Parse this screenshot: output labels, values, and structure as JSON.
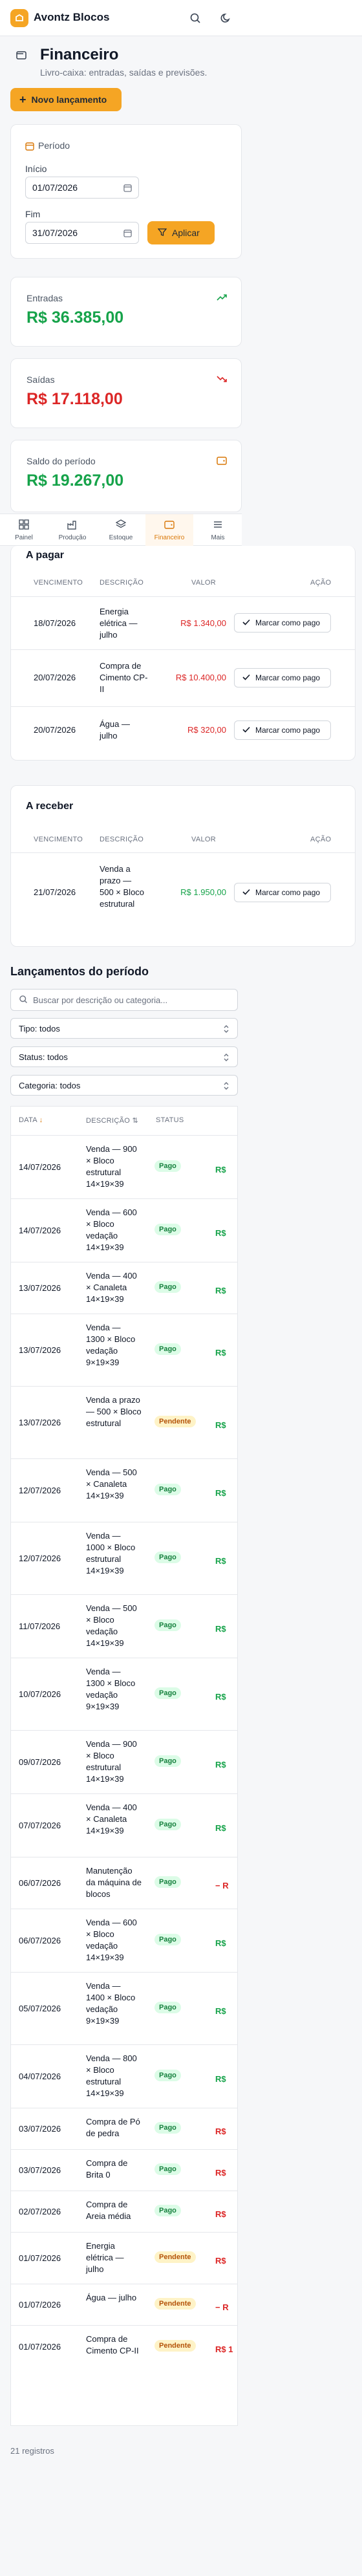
{
  "app": {
    "name": "Avontz Blocos"
  },
  "page": {
    "title": "Financeiro",
    "subtitle": "Livro-caixa: entradas, saídas e previsões.",
    "new_button": "Novo lançamento"
  },
  "period": {
    "title": "Período",
    "start_label": "Início",
    "start_value": "01/07/2026",
    "end_label": "Fim",
    "end_value": "31/07/2026",
    "apply_label": "Aplicar"
  },
  "stats": [
    {
      "label": "Entradas",
      "value": "R$ 36.385,00",
      "color": "#16a34a",
      "icon": "trending-up-icon"
    },
    {
      "label": "Saídas",
      "value": "R$ 17.118,00",
      "color": "#dc2626",
      "icon": "trending-down-icon"
    },
    {
      "label": "Saldo do período",
      "value": "R$ 19.267,00",
      "color": "#16a34a",
      "icon": "wallet-icon"
    }
  ],
  "nav": [
    {
      "label": "Painel",
      "icon": "grid-icon"
    },
    {
      "label": "Produção",
      "icon": "factory-icon"
    },
    {
      "label": "Estoque",
      "icon": "layers-icon"
    },
    {
      "label": "Financeiro",
      "icon": "wallet-icon",
      "active": true
    },
    {
      "label": "Mais",
      "icon": "menu-icon"
    }
  ],
  "payables": {
    "title": "A pagar",
    "headers": [
      "VENCIMENTO",
      "DESCRIÇÃO",
      "VALOR",
      "AÇÃO"
    ],
    "rows": [
      {
        "date": "18/07/2026",
        "desc": "Energia elétrica — julho",
        "value": "R$ 1.340,00",
        "action": "Marcar como pago"
      },
      {
        "date": "20/07/2026",
        "desc": "Compra de Cimento CP-II",
        "value": "R$ 10.400,00",
        "action": "Marcar como pago"
      },
      {
        "date": "20/07/2026",
        "desc": "Água — julho",
        "value": "R$ 320,00",
        "action": "Marcar como pago"
      }
    ]
  },
  "receivables": {
    "title": "A receber",
    "headers": [
      "VENCIMENTO",
      "DESCRIÇÃO",
      "VALOR",
      "AÇÃO"
    ],
    "rows": [
      {
        "date": "21/07/2026",
        "desc": "Venda a prazo — 500 × Bloco estrutural",
        "value": "R$ 1.950,00",
        "action": "Marcar como pago"
      }
    ]
  },
  "ledger": {
    "title": "Lançamentos do período",
    "search_placeholder": "Buscar por descrição ou categoria...",
    "filters": [
      "Tipo: todos",
      "Status: todos",
      "Categoria: todos"
    ],
    "headers": [
      "DATA",
      "DESCRIÇÃO",
      "STATUS"
    ],
    "rows": [
      {
        "date": "14/07/2026",
        "desc": "Venda — 900 × Bloco estrutural 14×19×39",
        "status": "Pago",
        "amount": "R$",
        "type": "in"
      },
      {
        "date": "14/07/2026",
        "desc": "Venda — 600 × Bloco vedação 14×19×39",
        "status": "Pago",
        "amount": "R$",
        "type": "in"
      },
      {
        "date": "13/07/2026",
        "desc": "Venda — 400 × Canaleta 14×19×39",
        "status": "Pago",
        "amount": "R$",
        "type": "in"
      },
      {
        "date": "13/07/2026",
        "desc": "Venda — 1300 × Bloco vedação 9×19×39",
        "status": "Pago",
        "amount": "R$",
        "type": "in"
      },
      {
        "date": "13/07/2026",
        "desc": "Venda a prazo — 500 × Bloco estrutural",
        "status": "Pendente",
        "amount": "R$",
        "type": "in"
      },
      {
        "date": "12/07/2026",
        "desc": "Venda — 500 × Canaleta 14×19×39",
        "status": "Pago",
        "amount": "R$",
        "type": "in"
      },
      {
        "date": "12/07/2026",
        "desc": "Venda — 1000 × Bloco estrutural 14×19×39",
        "status": "Pago",
        "amount": "R$",
        "type": "in"
      },
      {
        "date": "11/07/2026",
        "desc": "Venda — 500 × Bloco vedação 14×19×39",
        "status": "Pago",
        "amount": "R$",
        "type": "in"
      },
      {
        "date": "10/07/2026",
        "desc": "Venda — 1300 × Bloco vedação 9×19×39",
        "status": "Pago",
        "amount": "R$",
        "type": "in"
      },
      {
        "date": "09/07/2026",
        "desc": "Venda — 900 × Bloco estrutural 14×19×39",
        "status": "Pago",
        "amount": "R$",
        "type": "in"
      },
      {
        "date": "07/07/2026",
        "desc": "Venda — 400 × Canaleta 14×19×39",
        "status": "Pago",
        "amount": "R$",
        "type": "in"
      },
      {
        "date": "06/07/2026",
        "desc": "Manutenção da máquina de blocos",
        "status": "Pago",
        "amount": "− R",
        "type": "out"
      },
      {
        "date": "06/07/2026",
        "desc": "Venda — 600 × Bloco vedação 14×19×39",
        "status": "Pago",
        "amount": "R$",
        "type": "in"
      },
      {
        "date": "05/07/2026",
        "desc": "Venda — 1400 × Bloco vedação 9×19×39",
        "status": "Pago",
        "amount": "R$",
        "type": "in"
      },
      {
        "date": "04/07/2026",
        "desc": "Venda — 800 × Bloco estrutural 14×19×39",
        "status": "Pago",
        "amount": "R$",
        "type": "in"
      },
      {
        "date": "03/07/2026",
        "desc": "Compra de Pó de pedra",
        "status": "Pago",
        "amount": "R$",
        "type": "out"
      },
      {
        "date": "03/07/2026",
        "desc": "Compra de Brita 0",
        "status": "Pago",
        "amount": "R$",
        "type": "out"
      },
      {
        "date": "02/07/2026",
        "desc": "Compra de Areia média",
        "status": "Pago",
        "amount": "R$",
        "type": "out"
      },
      {
        "date": "01/07/2026",
        "desc": "Energia elétrica — julho",
        "status": "Pendente",
        "amount": "R$",
        "type": "out"
      },
      {
        "date": "01/07/2026",
        "desc": "Água — julho",
        "status": "Pendente",
        "amount": "− R",
        "type": "out"
      },
      {
        "date": "01/07/2026",
        "desc": "Compra de Cimento CP-II",
        "status": "Pendente",
        "amount": "R$ 1",
        "type": "out"
      }
    ],
    "count_label": "21 registros"
  }
}
